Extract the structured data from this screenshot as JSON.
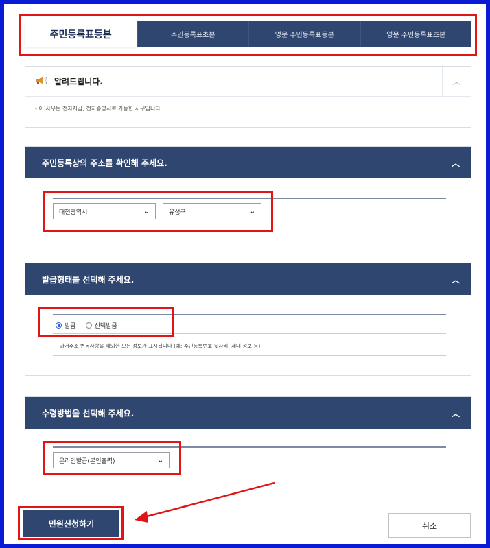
{
  "tabs": [
    {
      "label": "주민등록표등본",
      "active": true
    },
    {
      "label": "주민등록표초본",
      "active": false
    },
    {
      "label": "영문 주민등록표등본",
      "active": false
    },
    {
      "label": "영문 주민등록표초본",
      "active": false
    }
  ],
  "notice": {
    "title": "알려드립니다.",
    "icon": "megaphone-icon",
    "body": "- 이 사무는 전자지갑, 전자증명서로 가능한 사무입니다."
  },
  "address_section": {
    "title": "주민등록상의 주소를 확인해 주세요.",
    "city_select": "대전광역시",
    "district_select": "유성구"
  },
  "issue_section": {
    "title": "발급형태를 선택해 주세요.",
    "option_issue": "발급",
    "option_select_issue": "선택발급",
    "selected": "발급",
    "description": "과거주소 변동사항을 제외한 모든 정보가 표시됩니다 (예: 주민등록번호 뒷자리, 세대 정보 등)"
  },
  "receive_section": {
    "title": "수령방법을 선택해 주세요.",
    "method_select": "온라인발급(본인출력)"
  },
  "buttons": {
    "apply": "민원신청하기",
    "cancel": "취소"
  },
  "colors": {
    "frame": "#0a1bd6",
    "header": "#2f4670",
    "highlight": "#e01515"
  }
}
